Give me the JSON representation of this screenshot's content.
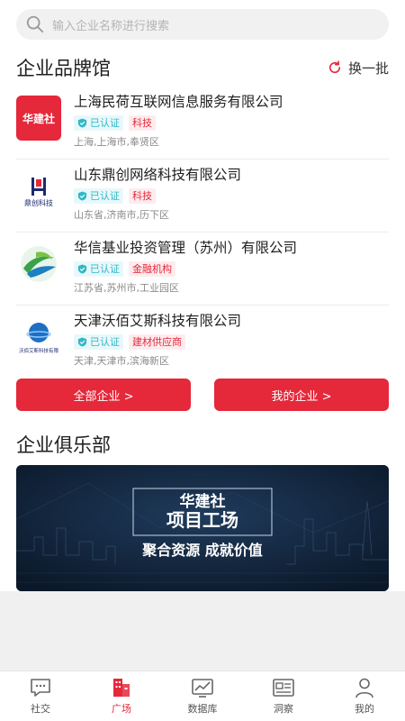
{
  "search": {
    "placeholder": "输入企业名称进行搜索"
  },
  "brand_section": {
    "title": "企业品牌馆",
    "refresh_label": "换一批",
    "companies": [
      {
        "name": "上海民荷互联网信息服务有限公司",
        "certified": "已认证",
        "industry": "科技",
        "location": "上海,上海市,奉贤区",
        "logo_text": "华建社"
      },
      {
        "name": "山东鼎创网络科技有限公司",
        "certified": "已认证",
        "industry": "科技",
        "location": "山东省,济南市,历下区",
        "logo_text": "鼎创科技"
      },
      {
        "name": "华信基业投资管理（苏州）有限公司",
        "certified": "已认证",
        "industry": "金融机构",
        "location": "江苏省,苏州市,工业园区",
        "logo_text": ""
      },
      {
        "name": "天津沃佰艾斯科技有限公司",
        "certified": "已认证",
        "industry": "建材供应商",
        "location": "天津,天津市,滨海新区",
        "logo_text": "沃佰艾斯科技有限"
      }
    ],
    "all_button": "全部企业 >",
    "mine_button": "我的企业 >"
  },
  "club_section": {
    "title": "企业俱乐部",
    "banner": {
      "brand": "华建社",
      "headline": "项目工场",
      "slogan": "聚合资源 成就价值"
    }
  },
  "tabbar": [
    {
      "label": "社交",
      "icon": "chat-icon",
      "active": false
    },
    {
      "label": "广场",
      "icon": "building-icon",
      "active": true
    },
    {
      "label": "数据库",
      "icon": "chart-icon",
      "active": false
    },
    {
      "label": "洞察",
      "icon": "newspaper-icon",
      "active": false
    },
    {
      "label": "我的",
      "icon": "user-icon",
      "active": false
    }
  ],
  "colors": {
    "accent": "#e5283a",
    "cert": "#2fb8c8",
    "banner_bg": "#0f2238"
  }
}
